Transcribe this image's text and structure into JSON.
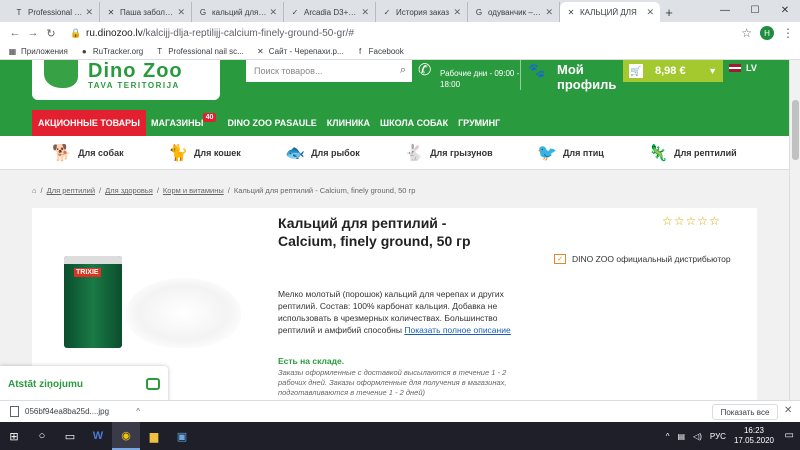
{
  "browser": {
    "tabs": [
      {
        "title": "Professional nail",
        "icon": "T",
        "active": false
      },
      {
        "title": "Паша заболела",
        "icon": "✕",
        "active": false
      },
      {
        "title": "кальций для че",
        "icon": "G",
        "active": false
      },
      {
        "title": "Arcadia D3+ Co",
        "icon": "✓",
        "active": false
      },
      {
        "title": "История заказ",
        "icon": "✓",
        "active": false
      },
      {
        "title": "одуванчик – Go",
        "icon": "G",
        "active": false
      },
      {
        "title": "КАЛЬЦИЙ ДЛЯ",
        "icon": "✕",
        "active": true
      }
    ],
    "url_host": "ru.dinozoo.lv",
    "url_path": "/kalcijj-dlja-reptilijj-calcium-finely-ground-50-gr/#",
    "profile_initial": "H",
    "bookmarks": [
      {
        "label": "Приложения",
        "icon": "▦"
      },
      {
        "label": "RuTracker.org",
        "icon": "●"
      },
      {
        "label": "Professional nail sc...",
        "icon": "T"
      },
      {
        "label": "Сайт - Черепахи.р...",
        "icon": "✕"
      },
      {
        "label": "Facebook",
        "icon": "f"
      }
    ]
  },
  "site": {
    "logo_title": "Dino Zoo",
    "logo_sub": "TAVA TERITORIJA",
    "search_placeholder": "Поиск товаров...",
    "hours_line1": "Рабочие дни - 09:00 -",
    "hours_line2": "18:00",
    "profile_line1": "Мой",
    "profile_line2": "профиль",
    "cart_total": "8,98 €",
    "lang": "LV",
    "nav": [
      {
        "label": "АКЦИОННЫЕ ТОВАРЫ",
        "promo": true
      },
      {
        "label": "МАГАЗИНЫ",
        "badge": "40"
      },
      {
        "label": "DINO ZOO PASAULE"
      },
      {
        "label": "КЛИНИКА"
      },
      {
        "label": "ШКОЛА СОБАК"
      },
      {
        "label": "ГРУМИНГ"
      }
    ],
    "categories": [
      {
        "label": "Для собак",
        "icon": "dog-icon",
        "glyph": "🐕"
      },
      {
        "label": "Для кошек",
        "icon": "cat-icon",
        "glyph": "🐈"
      },
      {
        "label": "Для рыбок",
        "icon": "fish-icon",
        "glyph": "🐟"
      },
      {
        "label": "Для грызунов",
        "icon": "rabbit-icon",
        "glyph": "🐇"
      },
      {
        "label": "Для птиц",
        "icon": "bird-icon",
        "glyph": "🐦"
      },
      {
        "label": "Для рептилий",
        "icon": "lizard-icon",
        "glyph": "🦎"
      }
    ],
    "breadcrumb": [
      "Для рептилий",
      "Для здоровья",
      "Корм и витамины",
      "Кальций для рептилий - Calcium, finely ground, 50 гр"
    ]
  },
  "product": {
    "title": "Кальций для рептилий - Calcium, finely ground, 50 гр",
    "brand_label": "TRIXIE",
    "description": "Мелко молотый (порошок) кальций для черепах и других рептилий. Состав: 100% карбонат кальция. Добавка не использовать в чрезмерных количествах. Большинство рептилий и амфибий способны",
    "more_link": "Показать полное описание",
    "stock": "Есть на складе.",
    "stock_note": "Заказы оформленные с доставкой высылаются в течение 1 - 2 рабочих дней. Заказы оформленные для получения в магазинах, подготавливаются в течение 1 - 2 дней)",
    "rating_stars": "☆☆☆☆☆",
    "distributor": "DINO ZOO официальный дистрибьютор"
  },
  "chat": {
    "label": "Atstāt ziņojumu"
  },
  "downloads": {
    "file": "056bf94ea8ba25d....jpg",
    "show_all": "Показать все"
  },
  "taskbar": {
    "lang": "РУС",
    "time": "16:23",
    "date": "17.05.2020"
  }
}
